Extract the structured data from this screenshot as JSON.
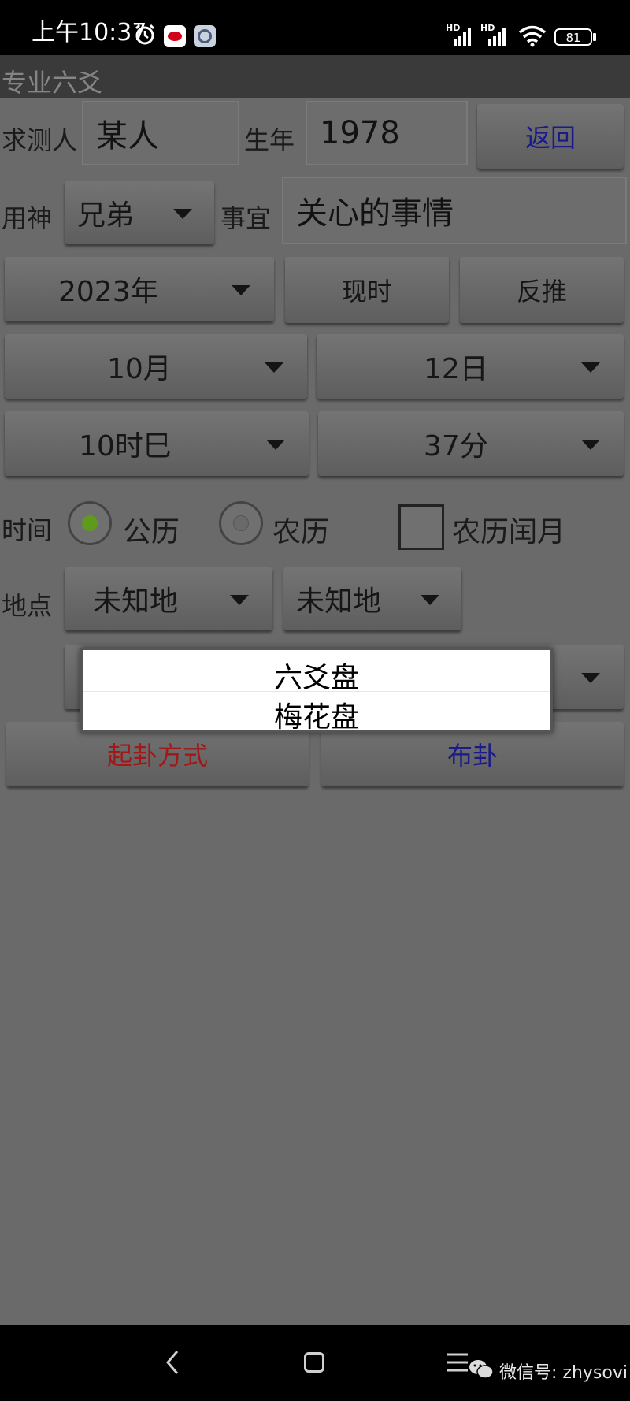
{
  "status_bar": {
    "time": "上午10:37",
    "battery": "81",
    "network_labels": [
      "HD",
      "HD"
    ]
  },
  "app_title": "专业六爻",
  "form": {
    "querent_label": "求测人",
    "querent_value": "某人",
    "birth_year_label": "生年",
    "birth_year_value": "1978",
    "back_button": "返回",
    "yongshen_label": "用神",
    "yongshen_value": "兄弟",
    "matter_label": "事宜",
    "matter_value": "关心的事情",
    "year_value": "2023年",
    "now_button": "现时",
    "reverse_button": "反推",
    "month_value": "10月",
    "day_value": "12日",
    "hour_value": "10时巳",
    "minute_value": "37分",
    "time_label": "时间",
    "gregorian_label": "公历",
    "lunar_label": "农历",
    "leap_month_label": "农历闰月",
    "location_label": "地点",
    "location1_value": "未知地",
    "location2_value": "未知地",
    "divination_method_button": "起卦方式",
    "cast_button": "布卦"
  },
  "popup": {
    "options": [
      "六爻盘",
      "梅花盘"
    ]
  },
  "watermark": "微信号: zhysovi",
  "colors": {
    "method_red": "#a01818",
    "action_blue": "#1a1a8a",
    "radio_green": "#5e9a1c"
  }
}
